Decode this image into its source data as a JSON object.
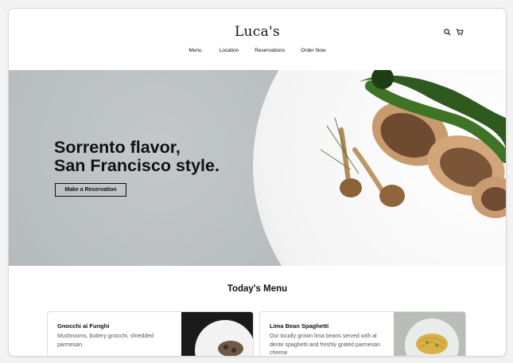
{
  "brand": {
    "logo": "Luca's"
  },
  "header": {
    "nav": [
      "Menu",
      "Location",
      "Reservations",
      "Order Now"
    ],
    "icons": [
      "search-icon",
      "cart-icon"
    ]
  },
  "hero": {
    "headline_line1": "Sorrento flavor,",
    "headline_line2": "San Francisco style.",
    "cta_label": "Make a Reservation"
  },
  "menu": {
    "title": "Today's Menu",
    "items": [
      {
        "name": "Gnocchi ai Funghi",
        "description": "Mushrooms, buttery gnocchi, shredded parmesan"
      },
      {
        "name": "Lima Bean Spaghetti",
        "description": "Our locally grown lima beans served with al dente spaghetti and freshly grated parmesan cheese"
      }
    ]
  },
  "colors": {
    "text": "#111111",
    "hero_bg": "#b7bcbf",
    "page_bg": "#f3f3f3"
  }
}
